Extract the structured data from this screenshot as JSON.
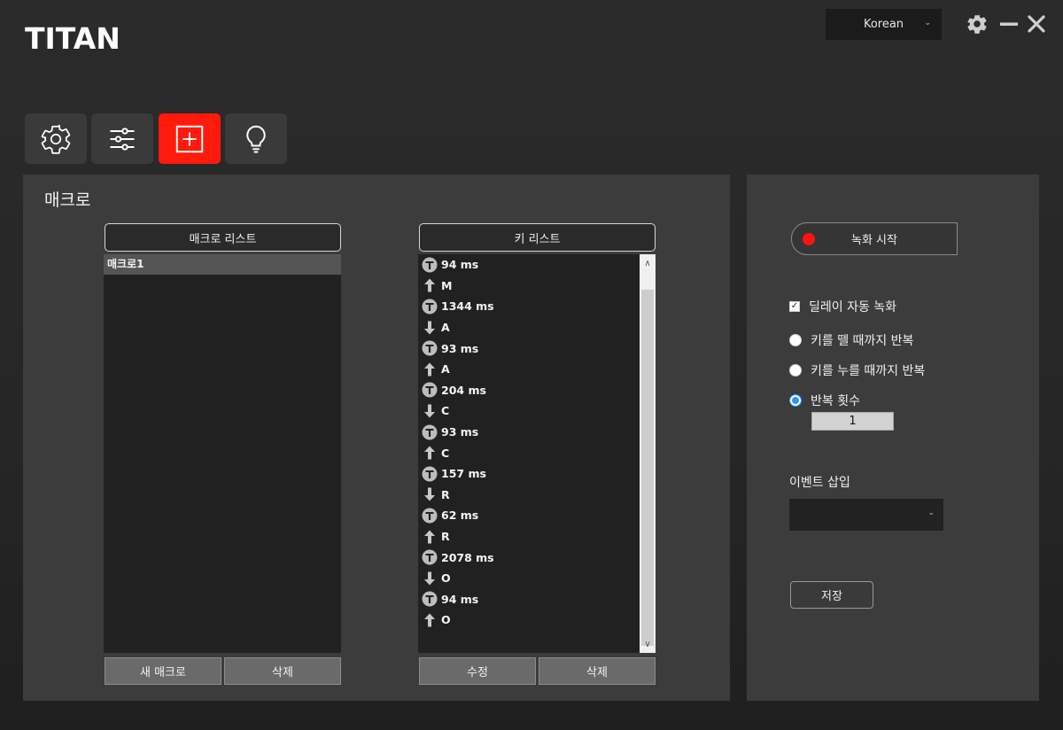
{
  "app": {
    "logo": "TITAN"
  },
  "header": {
    "language": "Korean",
    "icons": [
      "gear-icon",
      "minimize-icon",
      "close-icon"
    ]
  },
  "tabs": [
    {
      "icon": "settings-gear-icon",
      "active": false
    },
    {
      "icon": "sliders-icon",
      "active": false
    },
    {
      "icon": "macro-add-icon",
      "active": true
    },
    {
      "icon": "lightbulb-icon",
      "active": false
    }
  ],
  "macro_panel": {
    "title": "매크로",
    "macro_list": {
      "header": "매크로 리스트",
      "items": [
        "매크로1"
      ],
      "new_button": "새 매크로",
      "delete_button": "삭제"
    },
    "key_list": {
      "header": "키 리스트",
      "items": [
        {
          "icon": "timer-icon",
          "text": "94 ms"
        },
        {
          "icon": "arrow-up-icon",
          "text": "M"
        },
        {
          "icon": "timer-icon",
          "text": "1344 ms"
        },
        {
          "icon": "arrow-down-icon",
          "text": "A"
        },
        {
          "icon": "timer-icon",
          "text": "93 ms"
        },
        {
          "icon": "arrow-up-icon",
          "text": "A"
        },
        {
          "icon": "timer-icon",
          "text": "204 ms"
        },
        {
          "icon": "arrow-down-icon",
          "text": "C"
        },
        {
          "icon": "timer-icon",
          "text": "93 ms"
        },
        {
          "icon": "arrow-up-icon",
          "text": "C"
        },
        {
          "icon": "timer-icon",
          "text": "157 ms"
        },
        {
          "icon": "arrow-down-icon",
          "text": "R"
        },
        {
          "icon": "timer-icon",
          "text": "62 ms"
        },
        {
          "icon": "arrow-up-icon",
          "text": "R"
        },
        {
          "icon": "timer-icon",
          "text": "2078 ms"
        },
        {
          "icon": "arrow-down-icon",
          "text": "O"
        },
        {
          "icon": "timer-icon",
          "text": "94 ms"
        },
        {
          "icon": "arrow-up-icon",
          "text": "O"
        }
      ],
      "edit_button": "수정",
      "delete_button": "삭제"
    }
  },
  "record_panel": {
    "record_button": "녹화 시작",
    "auto_delay": {
      "label": "딜레이 자동 녹화",
      "checked": true
    },
    "repeat_options": [
      {
        "label": "키를 뗄 때까지 반복",
        "selected": false
      },
      {
        "label": "키를 누를 때까지 반복",
        "selected": false
      },
      {
        "label": "반복 횟수",
        "selected": true
      }
    ],
    "repeat_count": "1",
    "insert_event_label": "이벤트 삽입",
    "insert_event_value": "",
    "save_button": "저장"
  },
  "colors": {
    "accent": "#ff1a0c",
    "record_dot": "#ff1111",
    "radio_selected": "#2b95ff"
  }
}
